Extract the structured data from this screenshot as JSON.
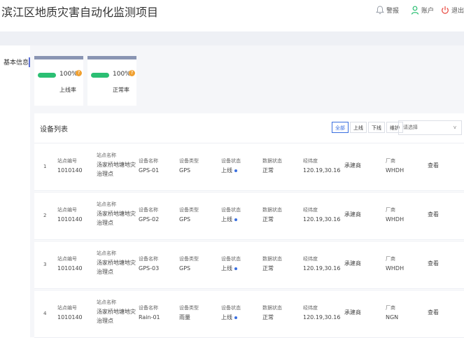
{
  "app": {
    "title": "滨江区地质灾害自动化监测项目",
    "actions": [
      {
        "label": "警报",
        "icon": "bell-icon"
      },
      {
        "label": "账户",
        "icon": "user-icon"
      },
      {
        "label": "退出",
        "icon": "power-icon"
      }
    ]
  },
  "sidebar": {
    "items": [
      {
        "label": "基本信息"
      }
    ]
  },
  "stats": [
    {
      "value": "100%",
      "label": "上线率",
      "badge": "?"
    },
    {
      "value": "100%",
      "label": "正常率",
      "badge": "?"
    }
  ],
  "device_list": {
    "title": "设备列表",
    "filters": [
      "全部",
      "上线",
      "下线",
      "维护"
    ],
    "active_filter": "全部",
    "select": {
      "placeholder": "请选择",
      "chevron": "v"
    },
    "field_labels": {
      "station_no": "站点编号",
      "station_name": "站点名称",
      "device_name": "设备名称",
      "device_type": "设备类型",
      "device_status": "设备状态",
      "data_status": "数据状态",
      "lonlat": "经纬度",
      "vendor": "厂商"
    },
    "view_label": "查看",
    "rows": [
      {
        "index": "1",
        "station_no": "1010140",
        "station_name_1": "汤家桥地塘地灾",
        "station_name_2": "治理点",
        "device_name": "GPS-01",
        "device_type": "GPS",
        "device_status": "上线",
        "data_status": "正常",
        "lonlat": "120.19,30.16",
        "builder": "承建商",
        "vendor": "WHDH"
      },
      {
        "index": "2",
        "station_no": "1010140",
        "station_name_1": "汤家桥地塘地灾",
        "station_name_2": "治理点",
        "device_name": "GPS-02",
        "device_type": "GPS",
        "device_status": "上线",
        "data_status": "正常",
        "lonlat": "120.19,30.16",
        "builder": "承建商",
        "vendor": "WHDH"
      },
      {
        "index": "3",
        "station_no": "1010140",
        "station_name_1": "汤家桥地塘地灾",
        "station_name_2": "治理点",
        "device_name": "GPS-03",
        "device_type": "GPS",
        "device_status": "上线",
        "data_status": "正常",
        "lonlat": "120.19,30.16",
        "builder": "承建商",
        "vendor": "WHDH"
      },
      {
        "index": "4",
        "station_no": "1010140",
        "station_name_1": "汤家桥地塘地灾",
        "station_name_2": "治理点",
        "device_name": "Rain-01",
        "device_type": "雨量",
        "device_status": "上线",
        "data_status": "正常",
        "lonlat": "120.19,30.16",
        "builder": "承建商",
        "vendor": "NGN"
      }
    ]
  },
  "colors": {
    "accent": "#3a6fe0",
    "success": "#2bbf73",
    "badge": "#f0a030",
    "bell": "#9aa0aa",
    "user": "#2bbf73",
    "power": "#e8453c"
  }
}
